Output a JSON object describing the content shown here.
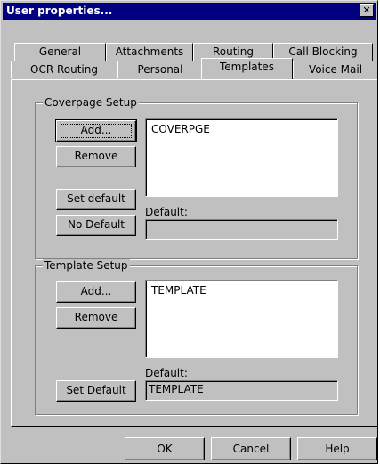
{
  "window": {
    "title": "User properties...",
    "close_glyph": "✕"
  },
  "tabs_row1": [
    {
      "label": "General"
    },
    {
      "label": "Attachments"
    },
    {
      "label": "Routing"
    },
    {
      "label": "Call Blocking"
    }
  ],
  "tabs_row2": [
    {
      "label": "OCR Routing"
    },
    {
      "label": "Personal"
    },
    {
      "label": "Templates",
      "selected": true
    },
    {
      "label": "Voice Mail"
    }
  ],
  "coverpage": {
    "group_label": "Coverpage Setup",
    "add_label": "Add...",
    "remove_label": "Remove",
    "set_default_label": "Set default",
    "no_default_label": "No Default",
    "list_items": [
      "COVERPGE"
    ],
    "default_label": "Default:",
    "default_value": ""
  },
  "template": {
    "group_label": "Template Setup",
    "add_label": "Add...",
    "remove_label": "Remove",
    "set_default_label": "Set Default",
    "list_items": [
      "TEMPLATE"
    ],
    "default_label": "Default:",
    "default_value": "TEMPLATE"
  },
  "footer": {
    "ok_label": "OK",
    "cancel_label": "Cancel",
    "help_label": "Help"
  }
}
